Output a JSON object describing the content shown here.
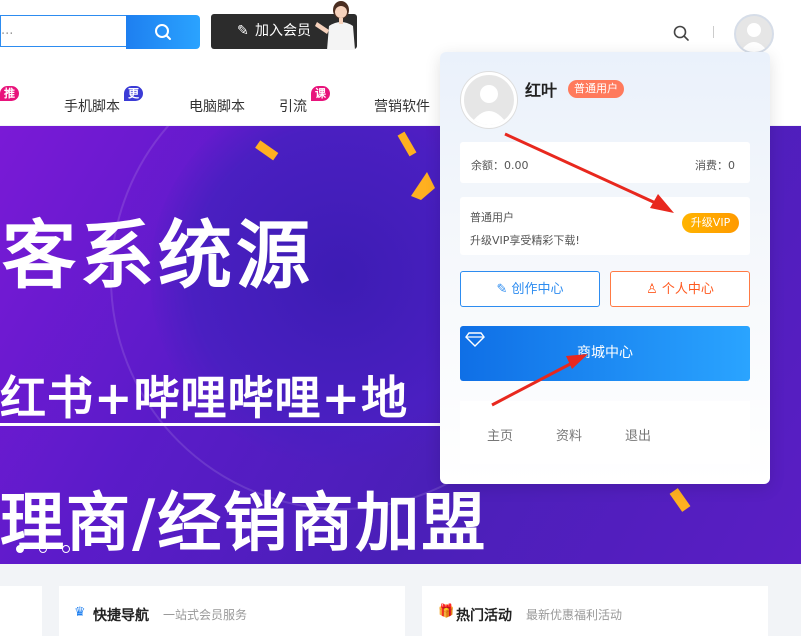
{
  "header": {
    "search_placeholder": "...",
    "join_label": "加入会员",
    "nav": [
      {
        "label": "推荐",
        "badge": true
      },
      {
        "label": "手机脚本",
        "badge_text": "更新"
      },
      {
        "label": "电脑脚本"
      },
      {
        "label": "引流",
        "badge_text": "课程"
      },
      {
        "label": "营销软件"
      }
    ],
    "badge_colors": {
      "hot": "#e8137b",
      "new": "#3b3bd6",
      "course": "#e8137b"
    }
  },
  "banner": {
    "line1": "客系统源",
    "line2": "红书+哔哩哔哩+地",
    "line3": "理商/经销商加盟",
    "dots": 3
  },
  "cards": [
    {
      "title": "快捷导航",
      "subtitle": "一站式会员服务"
    },
    {
      "title": "热门活动",
      "subtitle": "最新优惠福利活动"
    }
  ],
  "user_panel": {
    "name": "红叶",
    "level_tag": "普通用户",
    "balance_label": "余额：0.00",
    "spend_label": "消费：0",
    "member_type": "普通用户",
    "upgrade_tip": "升级VIP享受精彩下载!",
    "upgrade_button": "升级VIP",
    "creator_center": "创作中心",
    "personal_center": "个人中心",
    "mall_center": "商城中心",
    "links": [
      "主页",
      "资料",
      "退出"
    ]
  },
  "colors": {
    "accent_blue": "#1e7ff0",
    "orange": "#ff7a5c",
    "vip_gold": "#ffb400",
    "arrow_red": "#e8281e"
  }
}
